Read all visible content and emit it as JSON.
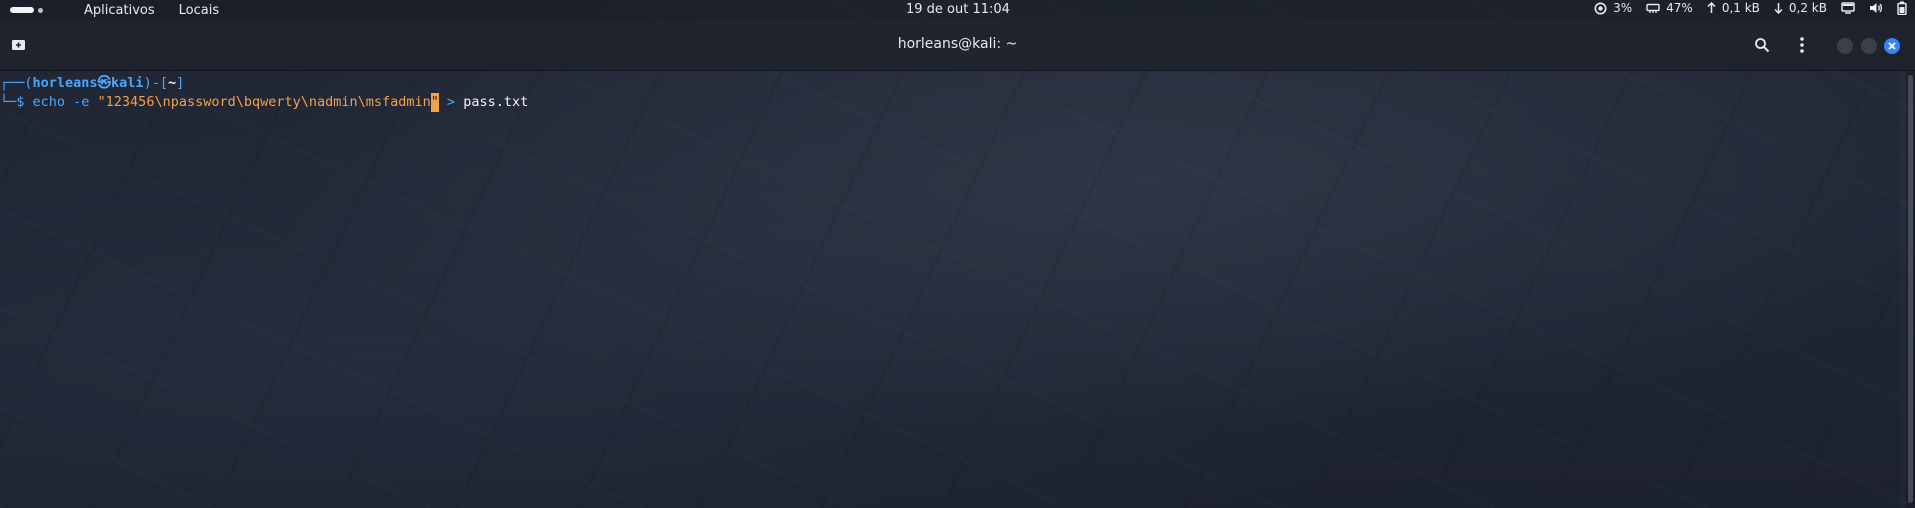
{
  "topbar": {
    "apps_label": "Aplicativos",
    "places_label": "Locais",
    "datetime": "19 de out  11:04",
    "cpu": "3%",
    "memory": "47%",
    "upload": "0,1 kB",
    "download": "0,2 kB"
  },
  "window": {
    "title": "horleans@kali: ~"
  },
  "terminal": {
    "prompt": {
      "frame_open": "┌──(",
      "user_host": "horleans㉿kali",
      "frame_mid": ")-[",
      "dir": "~",
      "frame_close": "]",
      "symbol": "└─$ "
    },
    "command": {
      "cmd": "echo",
      "flag": " -e ",
      "string": "\"123456\\npassword\\bqwerty\\nadmin\\msfadmin",
      "cursor_char": "\"",
      "redirect": " > ",
      "target": "pass.txt"
    }
  },
  "colors": {
    "accent": "#4aa6ff",
    "string": "#f0a24b",
    "close_button": "#3b82f6"
  }
}
